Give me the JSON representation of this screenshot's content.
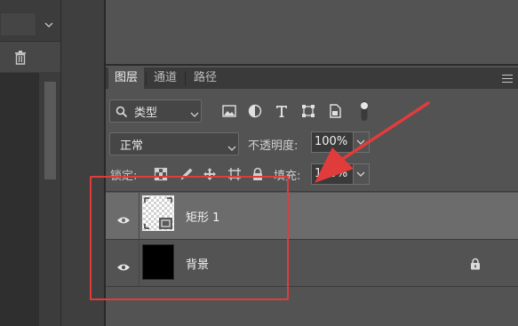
{
  "tabs": [
    {
      "label": "图层",
      "active": true
    },
    {
      "label": "通道",
      "active": false
    },
    {
      "label": "路径",
      "active": false
    }
  ],
  "filter": {
    "kind_label": "类型",
    "icons": [
      "image-filter-icon",
      "adjustment-filter-icon",
      "type-filter-icon",
      "shape-filter-icon",
      "smart-object-filter-icon",
      "filter-toggle-icon"
    ]
  },
  "blend": {
    "mode": "正常",
    "opacity_label": "不透明度:",
    "opacity_value": "100%"
  },
  "lock": {
    "label": "锁定:",
    "icons": [
      "lock-transparent-icon",
      "lock-pixels-icon",
      "lock-position-icon",
      "lock-artboard-icon",
      "lock-all-icon"
    ],
    "fill_label": "填充:",
    "fill_value": "100%"
  },
  "layers": [
    {
      "name": "矩形 1",
      "selected": true,
      "visible": true,
      "thumbnail": "transparent-shape",
      "locked": false
    },
    {
      "name": "背景",
      "selected": false,
      "visible": true,
      "thumbnail": "black",
      "locked": true
    }
  ],
  "colors": {
    "annotation_red": "#e03c3c",
    "panel_bg": "#535353",
    "selected_row": "#6c6c6c"
  }
}
